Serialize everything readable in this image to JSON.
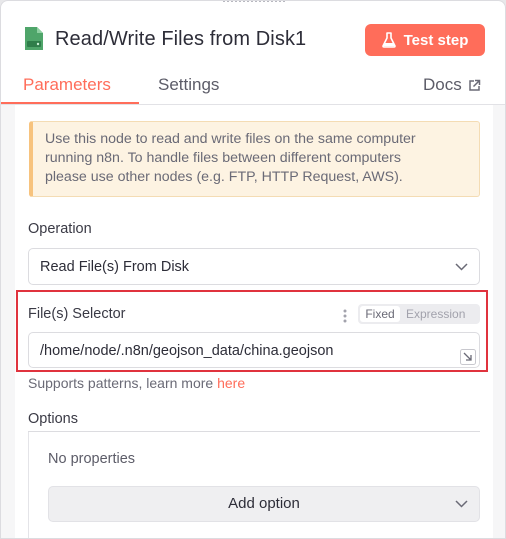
{
  "header": {
    "node_title": "Read/Write Files from Disk1",
    "test_button_label": "Test step",
    "accent_color": "#ff6d5a"
  },
  "tabs": [
    {
      "label": "Parameters",
      "active": true
    },
    {
      "label": "Settings",
      "active": false
    }
  ],
  "docs_label": "Docs",
  "notice": {
    "lines": [
      "Use this node to read and write files on the same computer",
      "running n8n. To handle files between different computers",
      "please use other nodes (e.g. FTP, HTTP Request, AWS)."
    ]
  },
  "operation": {
    "label": "Operation",
    "value": "Read File(s) From Disk"
  },
  "file_selector": {
    "label": "File(s) Selector",
    "mode_fixed": "Fixed",
    "mode_expression": "Expression",
    "value": "/home/node/.n8n/geojson_data/china.geojson",
    "hint_text": "Supports patterns, learn more",
    "hint_link": "here"
  },
  "options": {
    "label": "Options",
    "empty_text": "No properties",
    "add_button_label": "Add option"
  },
  "icons": {
    "node": "file-disk-icon",
    "test": "flask-icon",
    "docs": "external-link-icon",
    "dropdown": "chevron-down-icon",
    "field_menu": "kebab-menu-icon",
    "expand": "expand-icon"
  }
}
